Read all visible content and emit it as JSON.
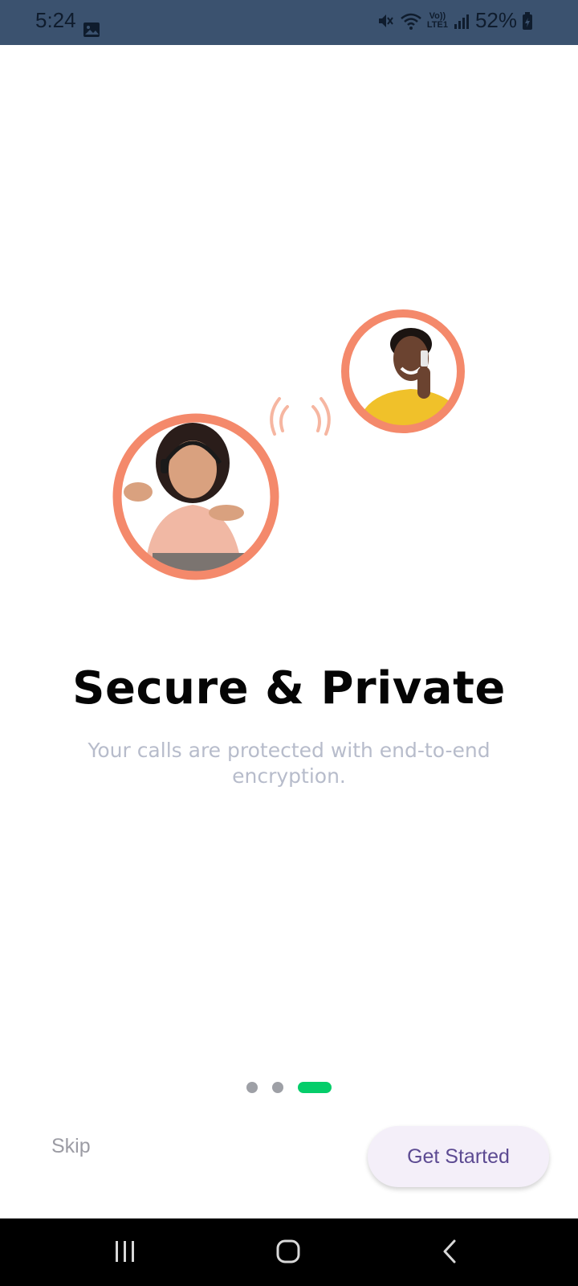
{
  "status_bar": {
    "time": "5:24",
    "battery": "52%",
    "network_label": "LTE1",
    "icons": [
      "image-icon",
      "mute-icon",
      "wifi-icon",
      "volte-icon",
      "signal-icon",
      "battery-icon"
    ]
  },
  "onboarding": {
    "title": "Secure & Private",
    "subtitle": "Your calls are protected with end-to-end encryption.",
    "pages_total": 3,
    "current_page": 3,
    "accent_color": "#05cd6a",
    "ring_color": "#f4896b"
  },
  "actions": {
    "skip_label": "Skip",
    "primary_label": "Get Started"
  },
  "nav": {
    "icons": [
      "recent-apps-icon",
      "home-icon",
      "back-icon"
    ]
  }
}
